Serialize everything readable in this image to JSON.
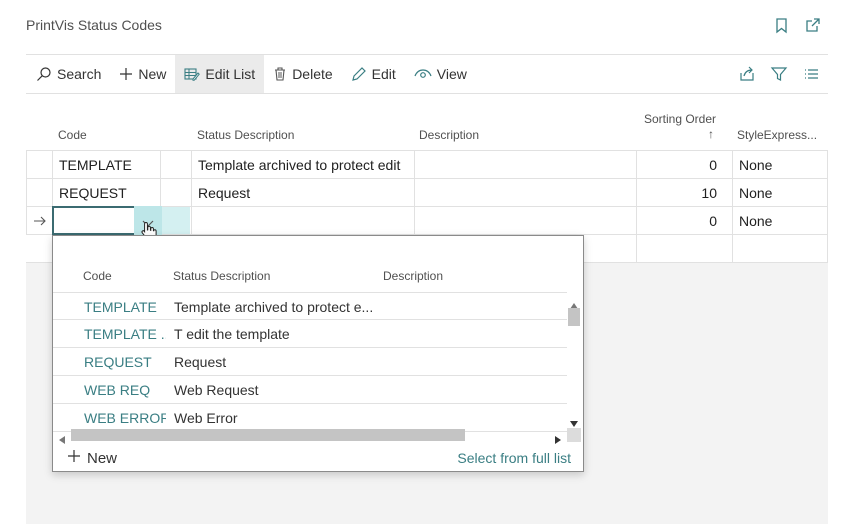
{
  "page": {
    "title": "PrintVis Status Codes",
    "icons": [
      "bookmark-icon",
      "open-new-window-icon"
    ]
  },
  "toolbar": {
    "search_label": "Search",
    "new_label": "New",
    "edit_list_label": "Edit List",
    "delete_label": "Delete",
    "edit_label": "Edit",
    "view_label": "View",
    "right_icons": [
      "share-icon",
      "filter-icon",
      "list-view-icon"
    ]
  },
  "grid": {
    "columns": {
      "code": "Code",
      "status_description": "Status Description",
      "description": "Description",
      "sorting_order": "Sorting Order",
      "sorting_arrow": "↑",
      "style_expression": "StyleExpress..."
    },
    "rows": [
      {
        "code": "TEMPLATE",
        "status_description": "Template archived to protect edit",
        "description": "",
        "sorting_order": "0",
        "style": "None"
      },
      {
        "code": "REQUEST",
        "status_description": "Request",
        "description": "",
        "sorting_order": "10",
        "style": "None"
      },
      {
        "code": "",
        "status_description": "",
        "description": "",
        "sorting_order": "0",
        "style": "None"
      }
    ]
  },
  "lookup": {
    "columns": {
      "code": "Code",
      "status_description": "Status Description",
      "description": "Description"
    },
    "rows": [
      {
        "code": "TEMPLATE",
        "status_description": "Template archived to protect e..."
      },
      {
        "code": "TEMPLATE ...",
        "status_description": "T edit the template"
      },
      {
        "code": "REQUEST",
        "status_description": "Request"
      },
      {
        "code": "WEB REQ",
        "status_description": "Web Request"
      },
      {
        "code": "WEB ERROR",
        "status_description": "Web Error"
      }
    ],
    "new_label": "New",
    "select_full_list_label": "Select from full list"
  },
  "colors": {
    "accent": "#3a7e83",
    "active_button_bg": "#ebebeb",
    "dropdown_highlight": "#bde6e8"
  }
}
